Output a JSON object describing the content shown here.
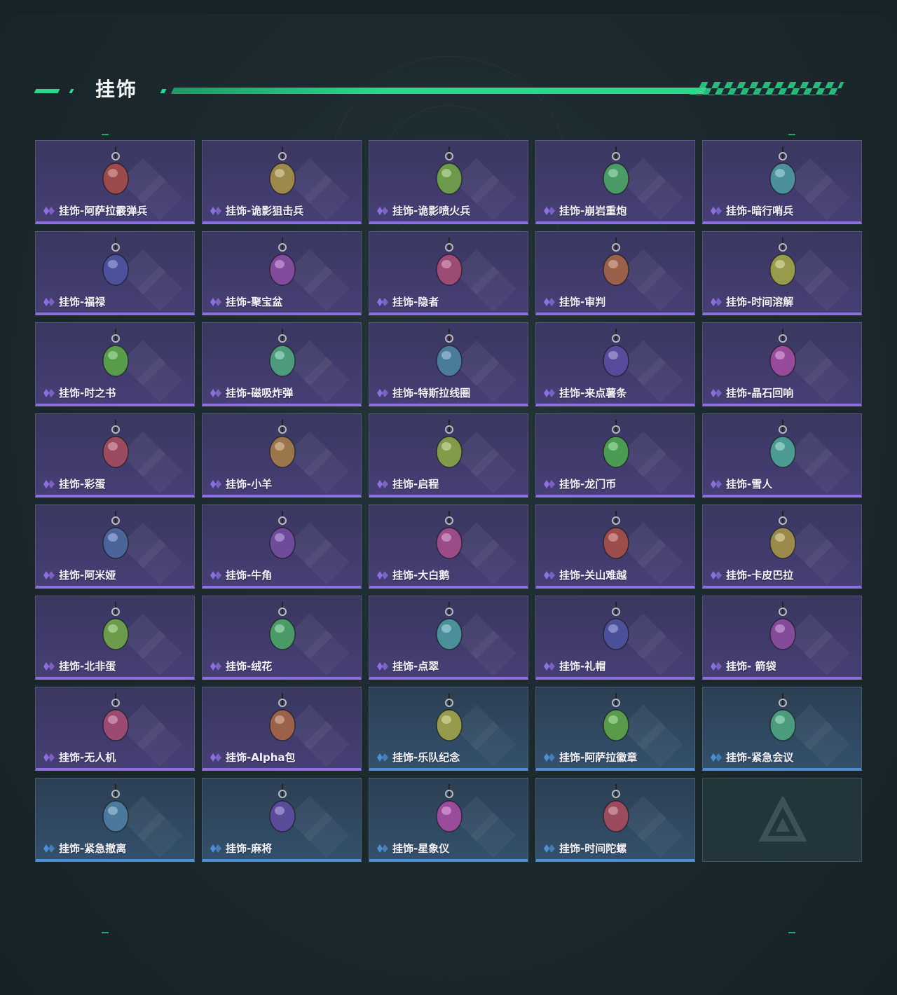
{
  "section": {
    "title": "挂饰"
  },
  "colors": {
    "accent": "#2bd88c",
    "purple_rarity": "#8d6fe0",
    "blue_rarity": "#4d8fd6"
  },
  "items": [
    {
      "label": "挂饰-阿萨拉霰弹兵",
      "rarity": "purple",
      "icon": "soldier-figure-charm-icon"
    },
    {
      "label": "挂饰-诡影狙击兵",
      "rarity": "purple",
      "icon": "masked-sniper-charm-icon"
    },
    {
      "label": "挂饰-诡影喷火兵",
      "rarity": "purple",
      "icon": "flamethrower-charm-icon"
    },
    {
      "label": "挂饰-崩岩重炮",
      "rarity": "purple",
      "icon": "heavy-gunner-charm-icon"
    },
    {
      "label": "挂饰-暗行哨兵",
      "rarity": "purple",
      "icon": "camo-sentry-charm-icon"
    },
    {
      "label": "挂饰-福禄",
      "rarity": "purple",
      "icon": "gourd-charm-icon"
    },
    {
      "label": "挂饰-聚宝盆",
      "rarity": "purple",
      "icon": "treasure-bowl-charm-icon"
    },
    {
      "label": "挂饰-隐者",
      "rarity": "purple",
      "icon": "hermit-card-charm-icon"
    },
    {
      "label": "挂饰-审判",
      "rarity": "purple",
      "icon": "judgement-card-charm-icon"
    },
    {
      "label": "挂饰-时间溶解",
      "rarity": "purple",
      "icon": "melting-clock-charm-icon"
    },
    {
      "label": "挂饰-时之书",
      "rarity": "purple",
      "icon": "book-charm-icon"
    },
    {
      "label": "挂饰-磁吸炸弹",
      "rarity": "purple",
      "icon": "magnetic-bomb-charm-icon"
    },
    {
      "label": "挂饰-特斯拉线圈",
      "rarity": "purple",
      "icon": "tesla-coil-charm-icon"
    },
    {
      "label": "挂饰-来点薯条",
      "rarity": "purple",
      "icon": "fries-charm-icon"
    },
    {
      "label": "挂饰-晶石回响",
      "rarity": "purple",
      "icon": "crystal-charm-icon"
    },
    {
      "label": "挂饰-彩蛋",
      "rarity": "purple",
      "icon": "easter-egg-charm-icon"
    },
    {
      "label": "挂饰-小羊",
      "rarity": "purple",
      "icon": "lamb-charm-icon"
    },
    {
      "label": "挂饰-启程",
      "rarity": "purple",
      "icon": "departure-ring-charm-icon"
    },
    {
      "label": "挂饰-龙门币",
      "rarity": "purple",
      "icon": "coin-card-charm-icon"
    },
    {
      "label": "挂饰-雪人",
      "rarity": "purple",
      "icon": "snowman-charm-icon"
    },
    {
      "label": "挂饰-阿米娅",
      "rarity": "purple",
      "icon": "rabbit-ear-charm-icon"
    },
    {
      "label": "挂饰-牛角",
      "rarity": "purple",
      "icon": "bull-horn-charm-icon"
    },
    {
      "label": "挂饰-大白鹅",
      "rarity": "purple",
      "icon": "white-goose-charm-icon"
    },
    {
      "label": "挂饰-关山难越",
      "rarity": "purple",
      "icon": "gold-bar-charm-icon"
    },
    {
      "label": "挂饰-卡皮巴拉",
      "rarity": "purple",
      "icon": "capybara-charm-icon"
    },
    {
      "label": "挂饰-北非蛋",
      "rarity": "purple",
      "icon": "shakshuka-charm-icon"
    },
    {
      "label": "挂饰-绒花",
      "rarity": "purple",
      "icon": "red-flower-charm-icon"
    },
    {
      "label": "挂饰-点翠",
      "rarity": "purple",
      "icon": "kingfisher-charm-icon"
    },
    {
      "label": "挂饰-礼帽",
      "rarity": "purple",
      "icon": "fedora-hat-charm-icon"
    },
    {
      "label": "挂饰- 箭袋",
      "rarity": "purple",
      "icon": "quiver-charm-icon"
    },
    {
      "label": "挂饰-无人机",
      "rarity": "purple",
      "icon": "drone-charm-icon"
    },
    {
      "label": "挂饰-Alpha包",
      "rarity": "purple",
      "icon": "alpha-bag-charm-icon"
    },
    {
      "label": "挂饰-乐队纪念",
      "rarity": "blue",
      "icon": "band-badge-charm-icon"
    },
    {
      "label": "挂饰-阿萨拉徽章",
      "rarity": "blue",
      "icon": "emblem-charm-icon"
    },
    {
      "label": "挂饰-紧急会议",
      "rarity": "blue",
      "icon": "meeting-figure-charm-icon"
    },
    {
      "label": "挂饰-紧急撤离",
      "rarity": "blue",
      "icon": "evac-cube-charm-icon"
    },
    {
      "label": "挂饰-麻将",
      "rarity": "blue",
      "icon": "mahjong-tile-charm-icon"
    },
    {
      "label": "挂饰-星象仪",
      "rarity": "blue",
      "icon": "astrolabe-charm-icon"
    },
    {
      "label": "挂饰-时间陀螺",
      "rarity": "blue",
      "icon": "spinning-top-charm-icon"
    }
  ],
  "empty_slot": {
    "icon": "placeholder-logo-icon"
  }
}
